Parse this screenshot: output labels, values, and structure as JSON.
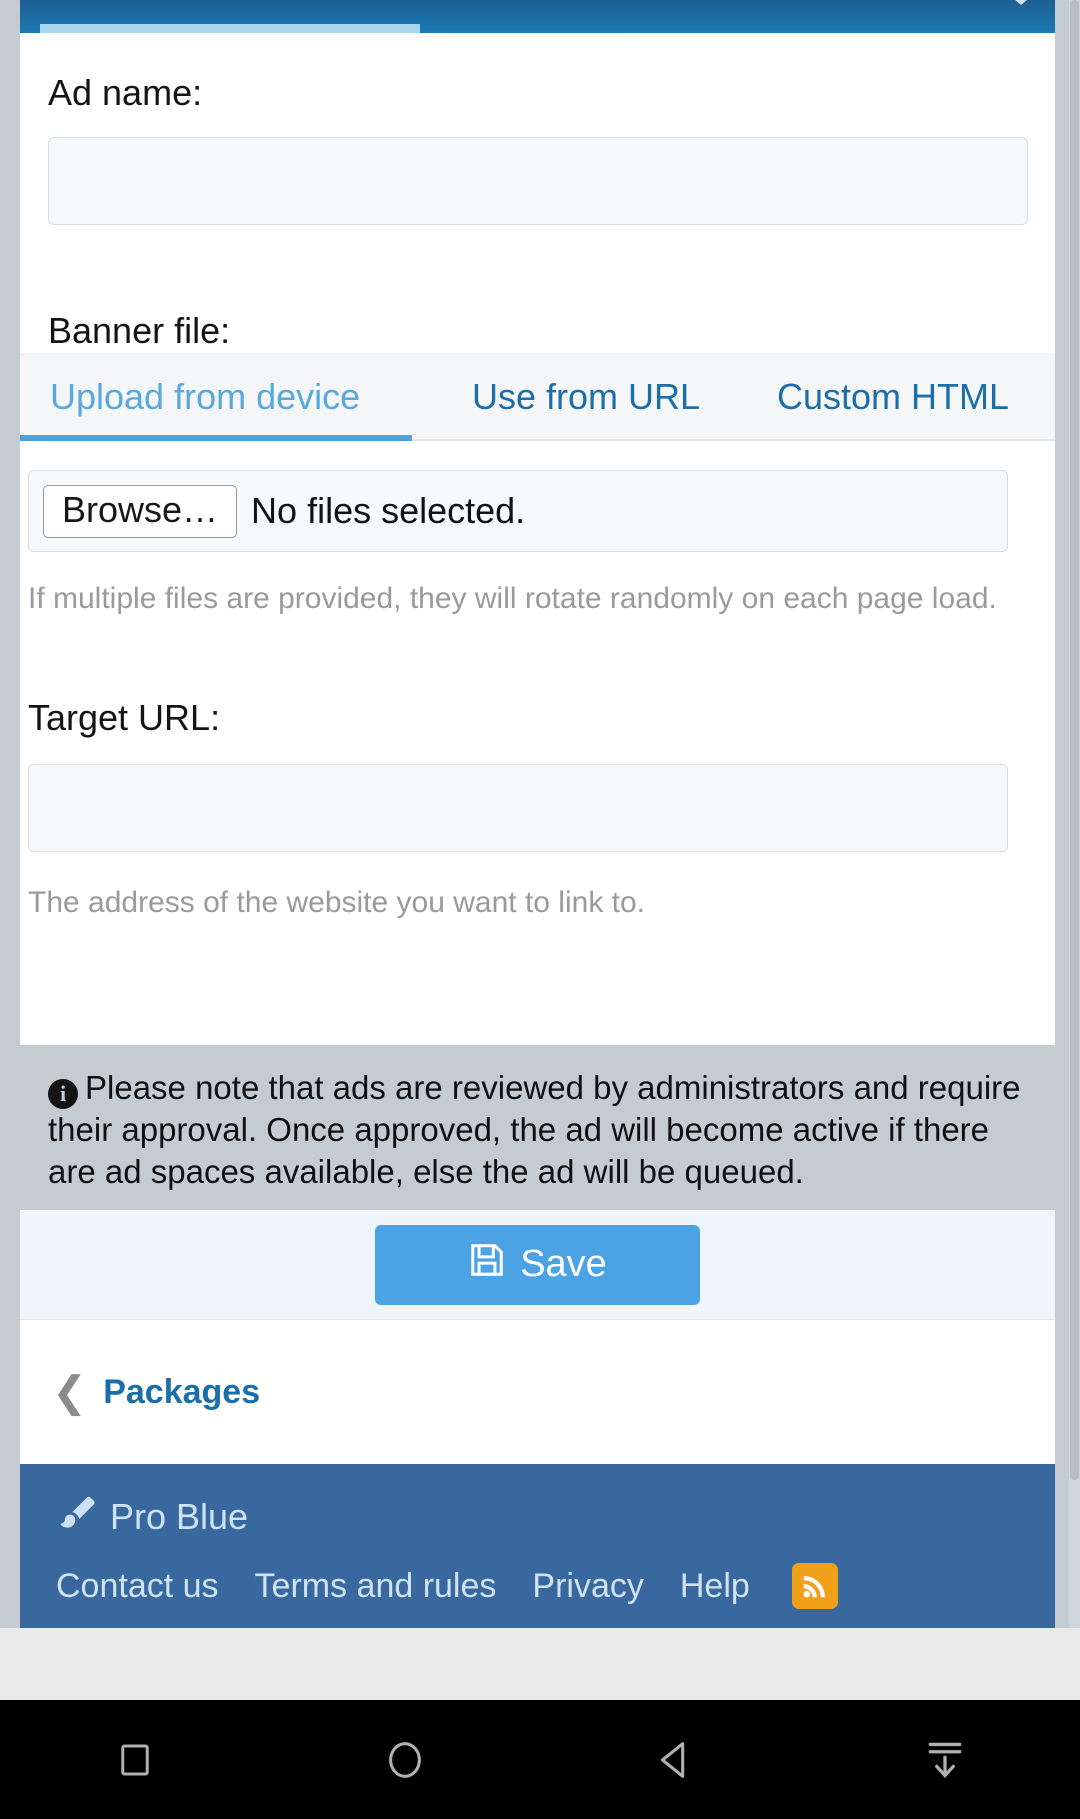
{
  "topbar": {
    "chevron_icon": "chevron-down-icon"
  },
  "form": {
    "ad_name": {
      "label": "Ad name:",
      "value": "",
      "placeholder": ""
    },
    "banner_file": {
      "label": "Banner file:",
      "tabs": [
        {
          "label": "Upload from device",
          "active": true
        },
        {
          "label": "Use from URL",
          "active": false
        },
        {
          "label": "Custom HTML",
          "active": false
        }
      ],
      "browse_button": "Browse…",
      "file_status": "No files selected.",
      "hint": "If multiple files are provided, they will rotate randomly on each page load."
    },
    "target_url": {
      "label": "Target URL:",
      "value": "",
      "placeholder": "",
      "hint": "The address of the website you want to link to."
    }
  },
  "notice": {
    "icon": "info-icon",
    "text": "Please note that ads are reviewed by administrators and require their approval. Once approved, the ad will become active if there are ad spaces available, else the ad will be queued."
  },
  "actions": {
    "save_label": "Save",
    "save_icon": "floppy-disk-icon",
    "save_color": "#4ba3e3"
  },
  "breadcrumb": {
    "back_icon": "chevron-left-icon",
    "label": "Packages"
  },
  "footer": {
    "brand_icon": "paintbrush-icon",
    "brand": "Pro Blue",
    "links": [
      "Contact us",
      "Terms and rules",
      "Privacy",
      "Help"
    ],
    "rss_icon": "rss-icon",
    "rss_color": "#f0a019",
    "background": "#39689f"
  },
  "navbar": {
    "buttons": [
      {
        "name": "recents-button",
        "icon": "square-icon"
      },
      {
        "name": "home-button",
        "icon": "circle-icon"
      },
      {
        "name": "back-button",
        "icon": "triangle-left-icon"
      },
      {
        "name": "hide-keyboard-button",
        "icon": "arrow-down-bar-icon"
      }
    ]
  }
}
